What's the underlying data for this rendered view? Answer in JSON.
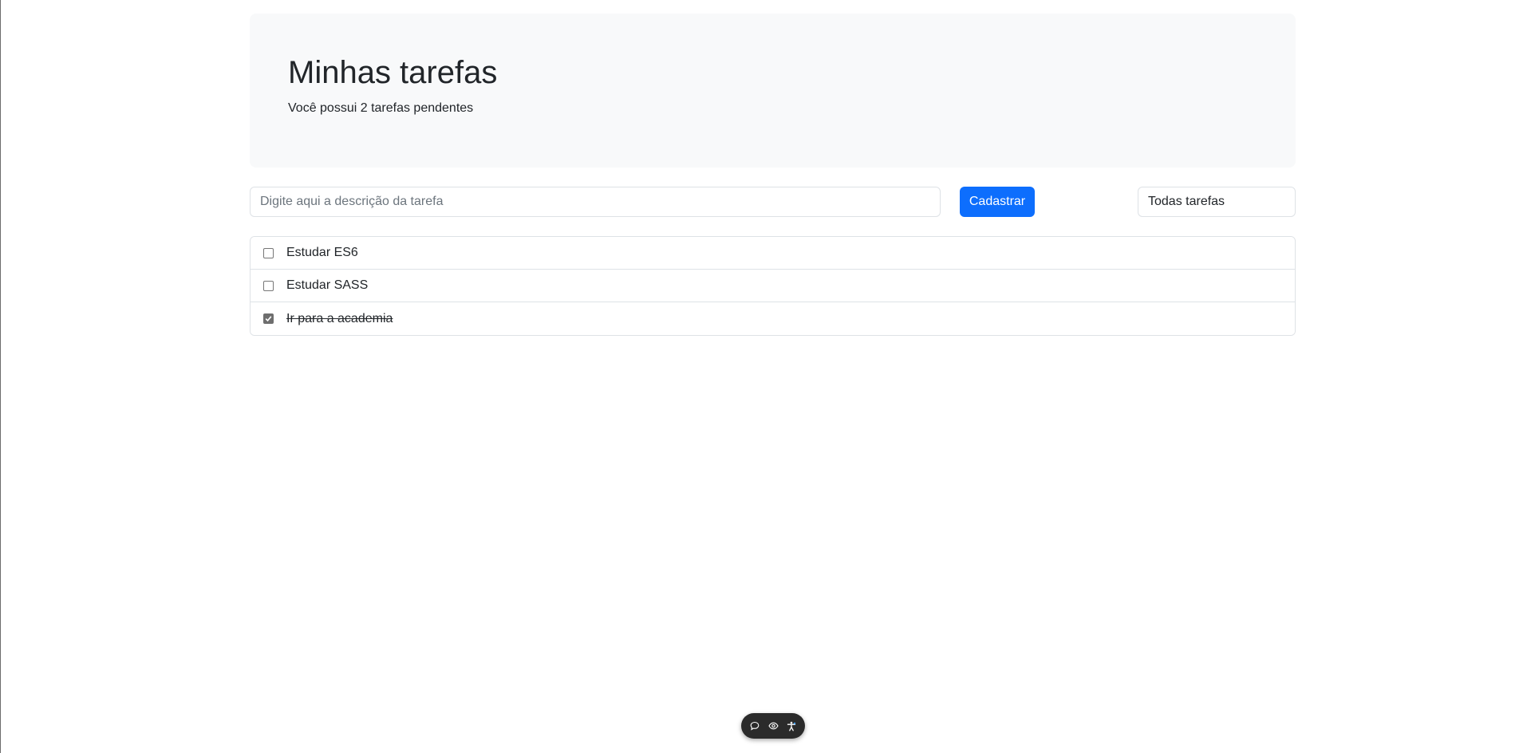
{
  "header": {
    "title": "Minhas tarefas",
    "subtitle": "Você possui 2 tarefas pendentes"
  },
  "form": {
    "input_placeholder": "Digite aqui a descrição da tarefa",
    "input_value": "",
    "submit_label": "Cadastrar",
    "filter_selected": "Todas tarefas"
  },
  "tasks": [
    {
      "label": "Estudar ES6",
      "done": false
    },
    {
      "label": "Estudar SASS",
      "done": false
    },
    {
      "label": "Ir para a academia",
      "done": true
    }
  ],
  "toolbar": {
    "icons": [
      "chat-bubble-icon",
      "eye-icon",
      "accessibility-icon"
    ]
  },
  "colors": {
    "primary": "#0d6efd",
    "hero_background": "#f8f9fa",
    "border": "#dee2e6",
    "toolbar_background": "#2b2b2b"
  }
}
